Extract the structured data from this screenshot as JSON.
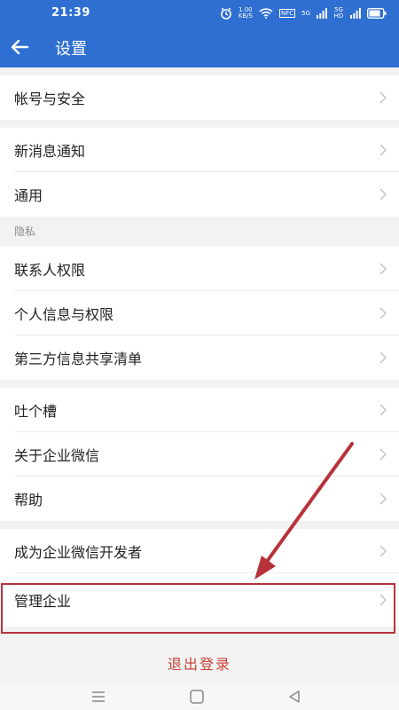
{
  "status_bar": {
    "time": "21:39",
    "speed_top": "1.00",
    "speed_bottom": "KB/S",
    "nfc": "NFC",
    "sim1": "5G",
    "sim2": "5G HD"
  },
  "header": {
    "title": "设置"
  },
  "sections": [
    {
      "items": [
        "帐号与安全"
      ]
    },
    {
      "items": [
        "新消息通知",
        "通用"
      ]
    },
    {
      "title": "隐私",
      "items": [
        "联系人权限",
        "个人信息与权限",
        "第三方信息共享清单"
      ]
    },
    {
      "items": [
        "吐个槽",
        "关于企业微信",
        "帮助"
      ]
    },
    {
      "items": [
        "成为企业微信开发者",
        "管理企业"
      ]
    }
  ],
  "logout_label": "退出登录",
  "colors": {
    "primary": "#2f6fd1",
    "annotation_red": "#b8323a",
    "logout_red": "#c8423a"
  }
}
